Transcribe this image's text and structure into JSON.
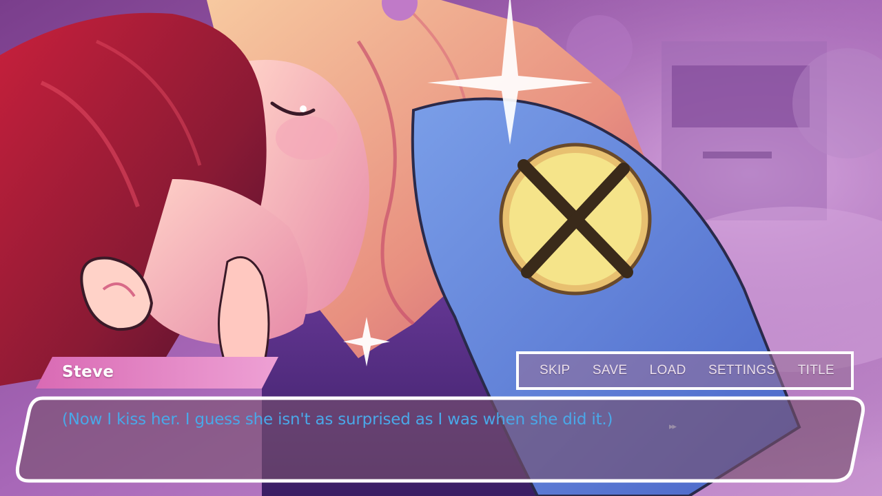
{
  "speaker": {
    "name": "Steve"
  },
  "dialogue": {
    "text": "(Now I kiss her. I guess she isn't as surprised as I was when she did it.)",
    "advance_glyph": "▸▸"
  },
  "quick_menu": {
    "skip": "SKIP",
    "save": "SAVE",
    "load": "LOAD",
    "settings": "SETTINGS",
    "title": "TITLE"
  },
  "colors": {
    "dialogue_text": "#4aa8e8",
    "name_plate": "#e58cc8",
    "menu_text": "#ebe0ec"
  }
}
